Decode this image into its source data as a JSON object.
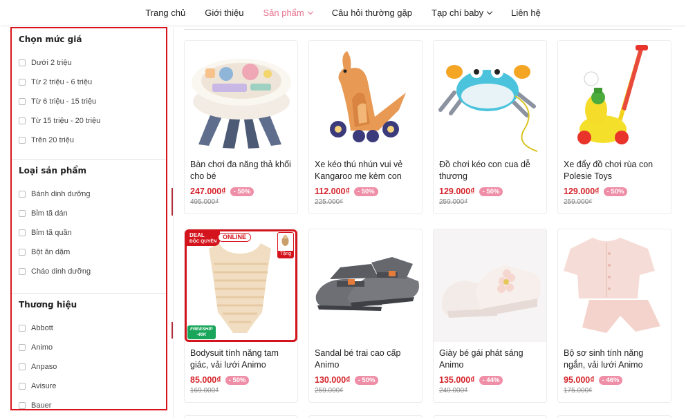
{
  "nav": {
    "items": [
      {
        "label": "Trang chủ"
      },
      {
        "label": "Giới thiệu"
      },
      {
        "label": "Sản phẩm"
      },
      {
        "label": "Câu hỏi thường gặp"
      },
      {
        "label": "Tạp chí baby"
      },
      {
        "label": "Liên hệ"
      }
    ],
    "active_color": "#e8748f"
  },
  "sidebar": {
    "price": {
      "title": "Chọn mức giá",
      "options": [
        "Dưới 2 triệu",
        "Từ 2 triệu - 6 triệu",
        "Từ 6 triệu - 15 triệu",
        "Từ 15 triệu - 20 triệu",
        "Trên 20 triệu"
      ]
    },
    "type": {
      "title": "Loại sản phẩm",
      "options": [
        "Bánh dinh dưỡng",
        "Bỉm tã dán",
        "Bỉm tã quần",
        "Bột ăn dặm",
        "Cháo dinh dưỡng"
      ]
    },
    "brand": {
      "title": "Thương hiệu",
      "options": [
        "Abbott",
        "Animo",
        "Anpaso",
        "Avisure",
        "Bauer"
      ]
    }
  },
  "products": [
    {
      "name": "Bàn chơi đa năng thả khối cho bé",
      "price": "247.000₫",
      "discount": "- 50%",
      "old_price": "495.000₫",
      "icon": "activity-table-toy"
    },
    {
      "name": "Xe kéo thú nhún vui vẻ Kangaroo mẹ kèm con",
      "price": "112.000₫",
      "discount": "- 50%",
      "old_price": "225.000₫",
      "icon": "kangaroo-pull-toy"
    },
    {
      "name": "Đồ chơi kéo con cua dễ thương",
      "price": "129.000₫",
      "discount": "- 50%",
      "old_price": "259.000₫",
      "icon": "crab-pull-toy"
    },
    {
      "name": "Xe đẩy đồ chơi rùa con Polesie Toys",
      "price": "129.000₫",
      "discount": "- 50%",
      "old_price": "259.000₫",
      "icon": "turtle-push-toy"
    },
    {
      "name": "Bodysuit tính năng tam giác, vải lưới Animo",
      "price": "85.000₫",
      "discount": "- 50%",
      "old_price": "169.000₫",
      "icon": "bodysuit",
      "badges": {
        "deal": "DEAL",
        "deal_sub": "ĐỘC QUYỀN",
        "online": "ONLINE",
        "gift": "Tặng",
        "freeship": "FREESHIP",
        "freeship_sub": "-40K"
      }
    },
    {
      "name": "Sandal bé trai cao cấp Animo",
      "price": "130.000₫",
      "discount": "- 50%",
      "old_price": "259.000₫",
      "icon": "boy-sandal"
    },
    {
      "name": "Giày bé gái phát sáng Animo",
      "price": "135.000₫",
      "discount": "- 44%",
      "old_price": "240.000₫",
      "icon": "girl-shoe"
    },
    {
      "name": "Bộ sơ sinh tính năng ngắn, vải lưới Animo",
      "price": "95.000₫",
      "discount": "- 46%",
      "old_price": "175.000₫",
      "icon": "newborn-outfit"
    }
  ],
  "colors": {
    "price": "#d4232a",
    "discount_badge": "#ee8ea7",
    "highlight_border": "#d9141c"
  }
}
